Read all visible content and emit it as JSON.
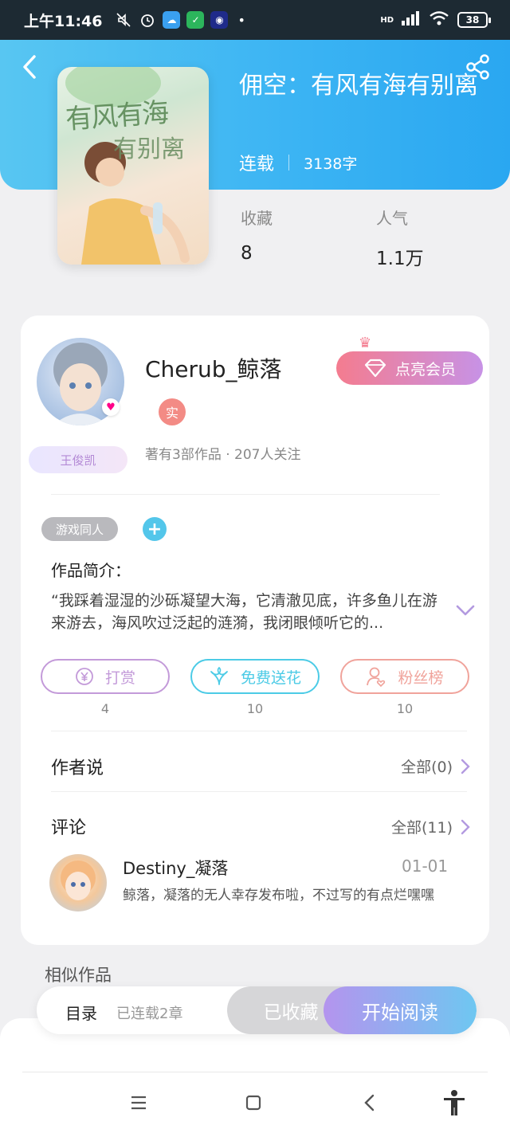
{
  "status_bar": {
    "time": "上午11:46",
    "battery": "38",
    "network": "HD"
  },
  "book": {
    "title": "佣空：有风有海有别离",
    "cover_text_main": "有风有海",
    "cover_text_sub": "有别离",
    "status": "连载",
    "word_count": "3138字",
    "stats": [
      {
        "label": "收藏",
        "value": "8"
      },
      {
        "label": "人气",
        "value": "1.1万"
      }
    ]
  },
  "author": {
    "name": "Cherub_鲸落",
    "verified_badge": "实",
    "fan_tag": "王俊凯",
    "stats": "著有3部作品 · 207人关注",
    "vip_button": "点亮会员"
  },
  "tags": {
    "genre": "游戏同人",
    "add": "+"
  },
  "intro": {
    "heading": "作品简介：",
    "text": "“我踩着湿湿的沙砾凝望大海，它清澈见底，许多鱼儿在游来游去，海风吹过泛起的涟漪，我闭眼倾听它的..."
  },
  "actions": [
    {
      "label": "打赏",
      "count": "4",
      "icon": "yen-coin-icon",
      "color": "#c39ad9"
    },
    {
      "label": "免费送花",
      "count": "10",
      "icon": "flower-icon",
      "color": "#4ccbe6"
    },
    {
      "label": "粉丝榜",
      "count": "10",
      "icon": "fan-user-icon",
      "color": "#f0a39b"
    }
  ],
  "author_says": {
    "title": "作者说",
    "more": "全部(0)"
  },
  "comments": {
    "title": "评论",
    "more": "全部(11)",
    "items": [
      {
        "user": "Destiny_凝落",
        "date": "01-01",
        "text": "鲸落，凝落的无人幸存发布啦，不过写的有点烂嘿嘿"
      }
    ]
  },
  "similar": {
    "title": "相似作品"
  },
  "bottom_bar": {
    "toc": "目录",
    "toc_status": "已连载2章",
    "collected": "已收藏",
    "start_reading": "开始阅读"
  },
  "colors": {
    "header_accent": "#3ab3f3",
    "vip_gradient_start": "#f47c8f",
    "vip_gradient_end": "#c792e6",
    "read_gradient_start": "#b494ee",
    "read_gradient_end": "#6ec7f1"
  }
}
